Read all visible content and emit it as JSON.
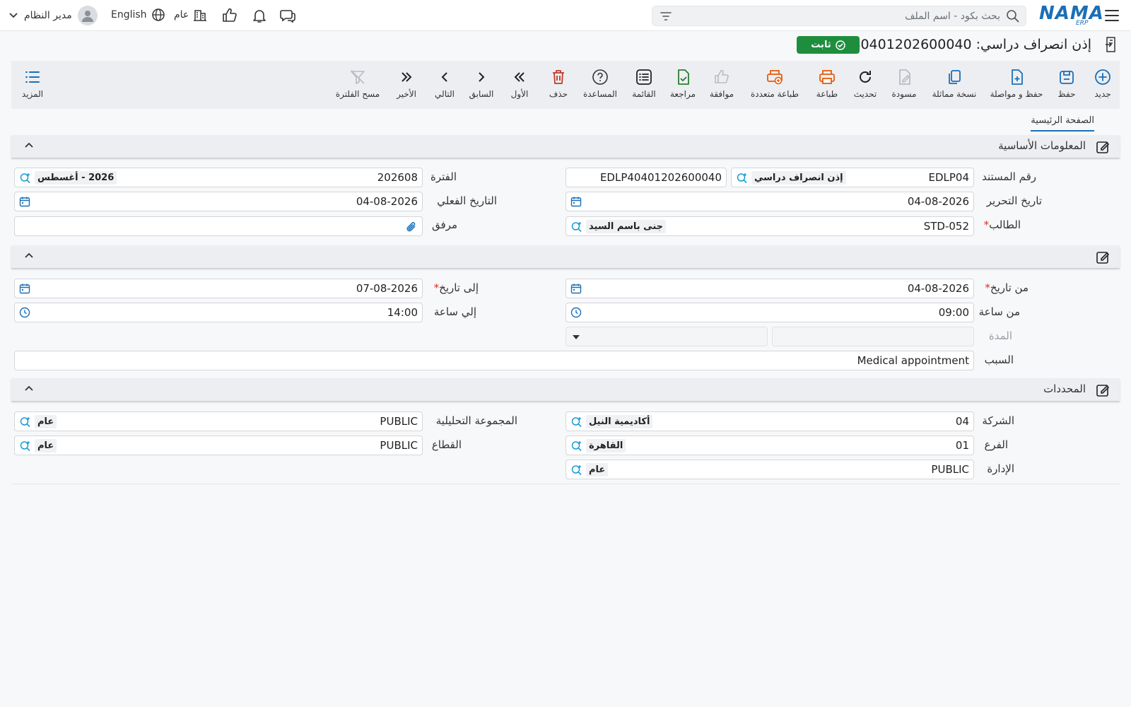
{
  "topbar": {
    "logo": "NAMA",
    "logo_sub": "ERP",
    "search_placeholder": "بحث بكود - اسم الملف",
    "language": "English",
    "scope": "عام",
    "user": "مدير النظام"
  },
  "header": {
    "title": "إذن انصراف دراسي: EDLP40401202600040",
    "status": "ثابت"
  },
  "toolbar": {
    "items": [
      {
        "label": "جديد",
        "icon": "plus-circle-icon"
      },
      {
        "label": "حفظ",
        "icon": "save-icon"
      },
      {
        "label": "حفظ و مواصلة",
        "icon": "file-plus-icon"
      },
      {
        "label": "نسخة مماثلة",
        "icon": "copy-icon"
      },
      {
        "label": "مسودة",
        "icon": "draft-icon"
      },
      {
        "label": "تحديث",
        "icon": "refresh-icon"
      },
      {
        "label": "طباعة",
        "icon": "print-icon"
      },
      {
        "label": "طباعة متعددة",
        "icon": "multi-print-icon"
      },
      {
        "label": "موافقة",
        "icon": "thumbs-up-icon"
      },
      {
        "label": "مراجعة",
        "icon": "file-check-icon"
      },
      {
        "label": "القائمة",
        "icon": "list-icon"
      },
      {
        "label": "المساعدة",
        "icon": "help-icon"
      },
      {
        "label": "حذف",
        "icon": "trash-icon"
      },
      {
        "label": "الأول",
        "icon": "first-icon"
      },
      {
        "label": "السابق",
        "icon": "previous-icon"
      },
      {
        "label": "التالي",
        "icon": "next-icon"
      },
      {
        "label": "الأخير",
        "icon": "last-icon"
      },
      {
        "label": "مسح الفلترة",
        "icon": "clear-filter-icon"
      }
    ],
    "more_label": "المزيد"
  },
  "tabs": {
    "main": "الصفحة الرئيسية"
  },
  "basic": {
    "title": "المعلومات الأساسية",
    "doc_number_label": "رقم المستند",
    "doc_number_code": "EDLP04",
    "doc_number_type": "إذن انصراف دراسي",
    "doc_number_value": "EDLP40401202600040",
    "period_label": "الفترة",
    "period_value": "202608",
    "period_desc": "2026 - أغسطس",
    "issue_date_label": "تاريخ التحرير",
    "issue_date_value": "04-08-2026",
    "actual_date_label": "التاريخ الفعلي",
    "actual_date_value": "04-08-2026",
    "student_label": "الطالب",
    "student_code": "STD-052",
    "student_name": "جنى باسم السيد",
    "attachment_label": "مرفق"
  },
  "leave": {
    "from_date_label": "من تاريخ",
    "from_date_value": "04-08-2026",
    "to_date_label": "إلى تاريخ",
    "to_date_value": "07-08-2026",
    "from_time_label": "من ساعة",
    "from_time_value": "09:00",
    "to_time_label": "إلي ساعة",
    "to_time_value": "14:00",
    "duration_label": "المدة",
    "reason_label": "السبب",
    "reason_value": "Medical appointment"
  },
  "dimensions": {
    "title": "المحددات",
    "company_label": "الشركة",
    "company_code": "04",
    "company_name": "أكاديمية النيل",
    "analytic_label": "المجموعة التحليلية",
    "analytic_code": "PUBLIC",
    "analytic_name": "عام",
    "branch_label": "الفرع",
    "branch_code": "01",
    "branch_name": "القاهرة",
    "sector_label": "القطاع",
    "sector_code": "PUBLIC",
    "sector_name": "عام",
    "department_label": "الإدارة",
    "department_code": "PUBLIC",
    "department_name": "عام"
  },
  "colors": {
    "brand": "#1b6fb6",
    "status": "#1e8e3e",
    "print": "#e8590c",
    "delete": "#c0392b",
    "review": "#2e7d32"
  }
}
